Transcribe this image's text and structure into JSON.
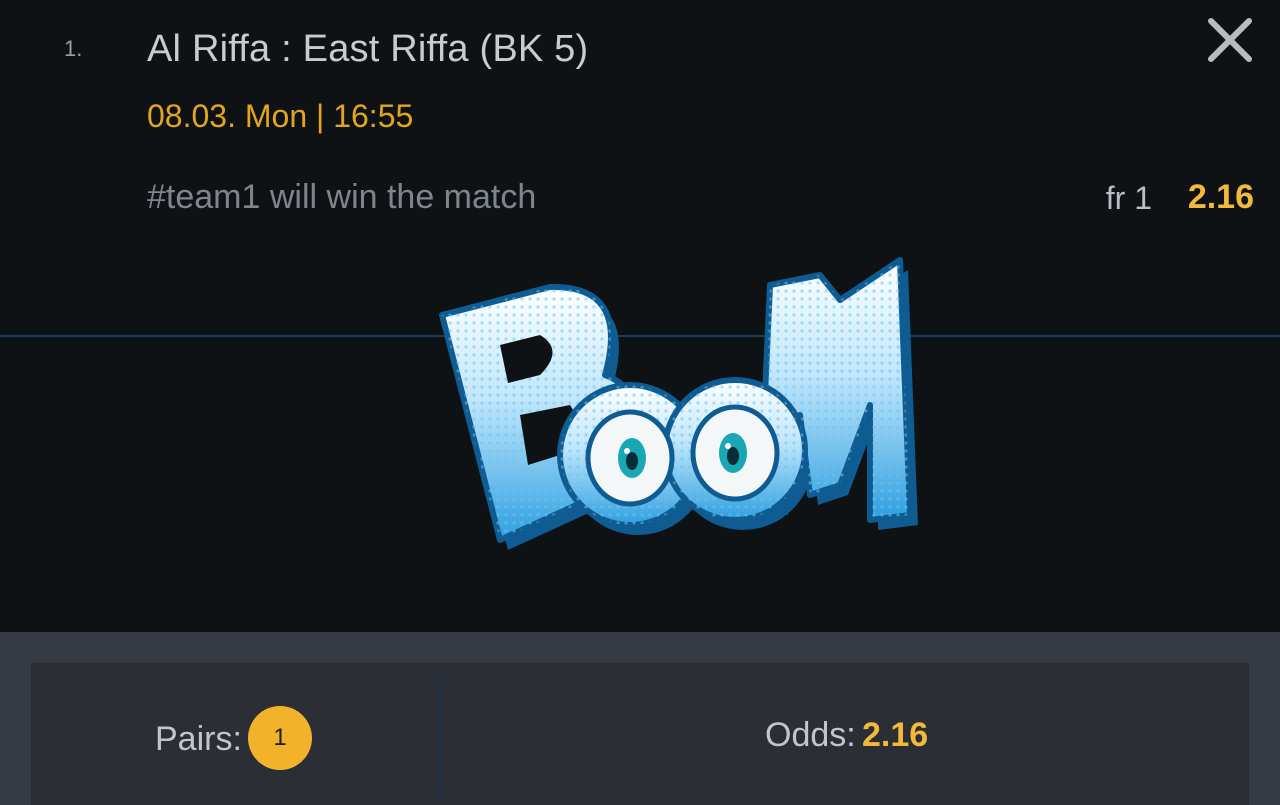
{
  "bet": {
    "index": "1.",
    "match": "Al Riffa : East Riffa (BK 5)",
    "datetime": "08.03. Mon | 16:55",
    "description": "#team1 will win the match",
    "outcome": "fr 1",
    "odd": "2.16"
  },
  "close_icon": "close-icon",
  "banner": {
    "text": "BOOM",
    "colors": {
      "top": "#ffffff",
      "bottom": "#2f9fe0",
      "outline": "#0e5c92"
    }
  },
  "summary": {
    "pairs_label": "Pairs:",
    "pairs_count": "1",
    "odds_label": "Odds:",
    "odds_value": "2.16"
  },
  "colors": {
    "accent": "#f2b93a",
    "date": "#e3a51f",
    "background": "#0f1215",
    "footer": "#363a42"
  }
}
